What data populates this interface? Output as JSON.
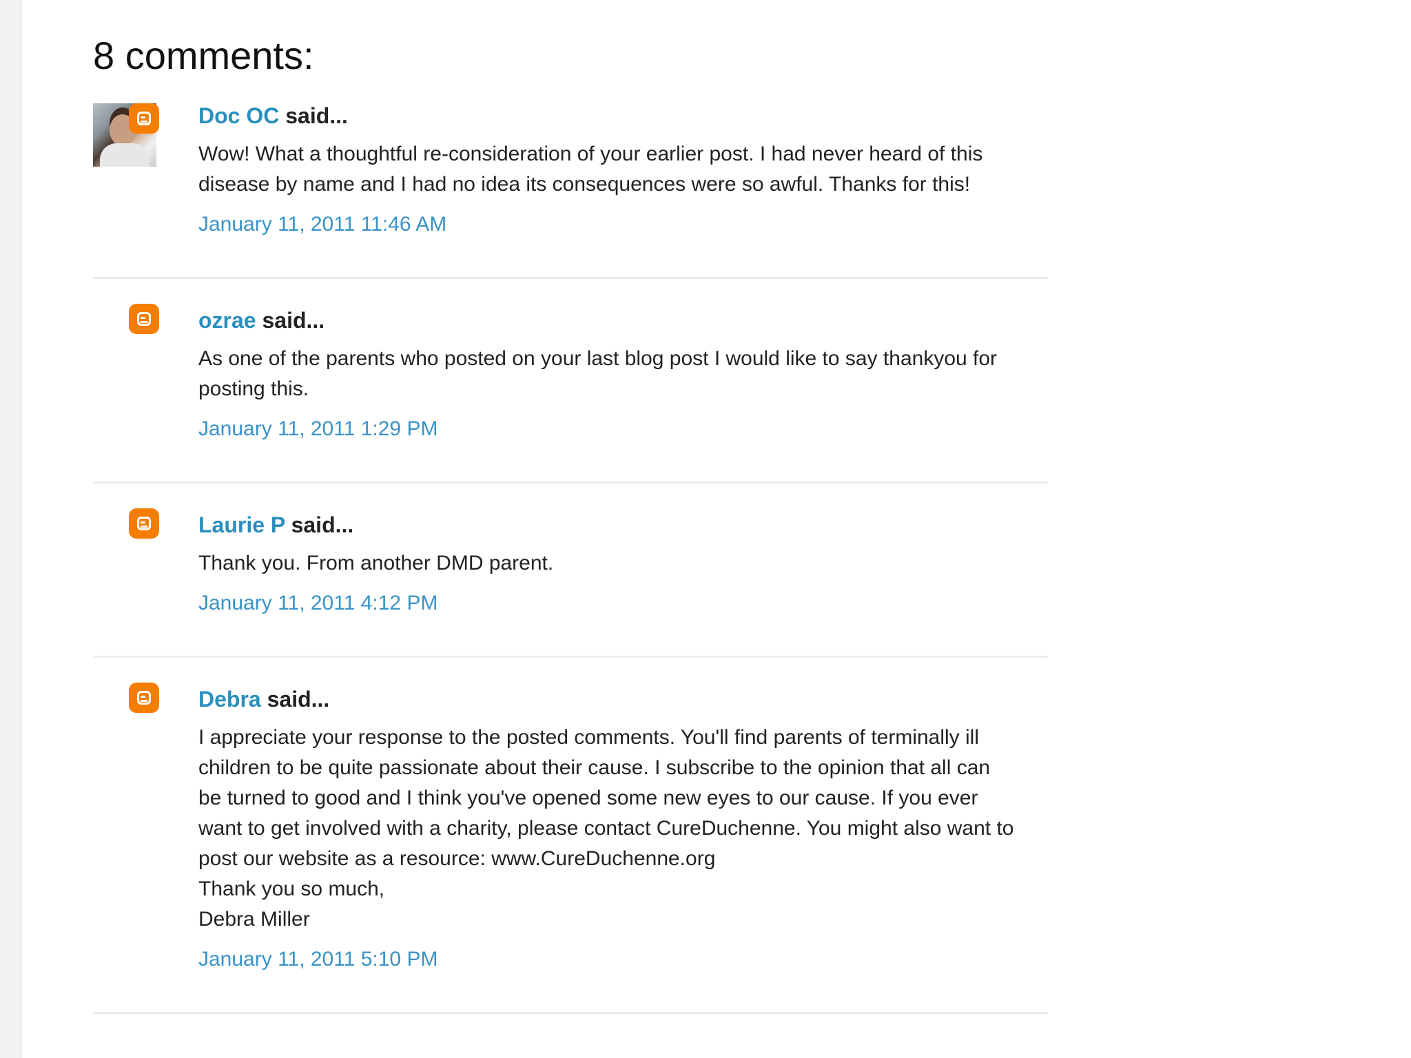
{
  "heading": "8 comments:",
  "comments": [
    {
      "author": "Doc OC",
      "said": "said...",
      "avatar": "photo-with-blogger-badge",
      "text": "Wow! What a thoughtful re-consideration of your earlier post. I had never heard of this disease by name and I had no idea its consequences were so awful. Thanks for this!",
      "timestamp": "January 11, 2011 11:46 AM"
    },
    {
      "author": "ozrae",
      "said": "said...",
      "avatar": "blogger-icon",
      "text": "As one of the parents who posted on your last blog post I would like to say thankyou for posting this.",
      "timestamp": "January 11, 2011 1:29 PM"
    },
    {
      "author": "Laurie P",
      "said": "said...",
      "avatar": "blogger-icon",
      "text": "Thank you. From another DMD parent.",
      "timestamp": "January 11, 2011 4:12 PM"
    },
    {
      "author": "Debra",
      "said": "said...",
      "avatar": "blogger-icon",
      "text": "I appreciate your response to the posted comments. You'll find parents of terminally ill children to be quite passionate about their cause. I subscribe to the opinion that all can be turned to good and I think you've opened some new eyes to our cause. If you ever want to get involved with a charity, please contact CureDuchenne. You might also want to post our website as a resource: www.CureDuchenne.org\nThank you so much,\nDebra Miller",
      "timestamp": "January 11, 2011 5:10 PM"
    }
  ],
  "colors": {
    "link": "#2a8fbd",
    "timestamp": "#3a92c7",
    "blogger_orange": "#f57d00",
    "text": "#222222",
    "divider": "#ececec"
  }
}
